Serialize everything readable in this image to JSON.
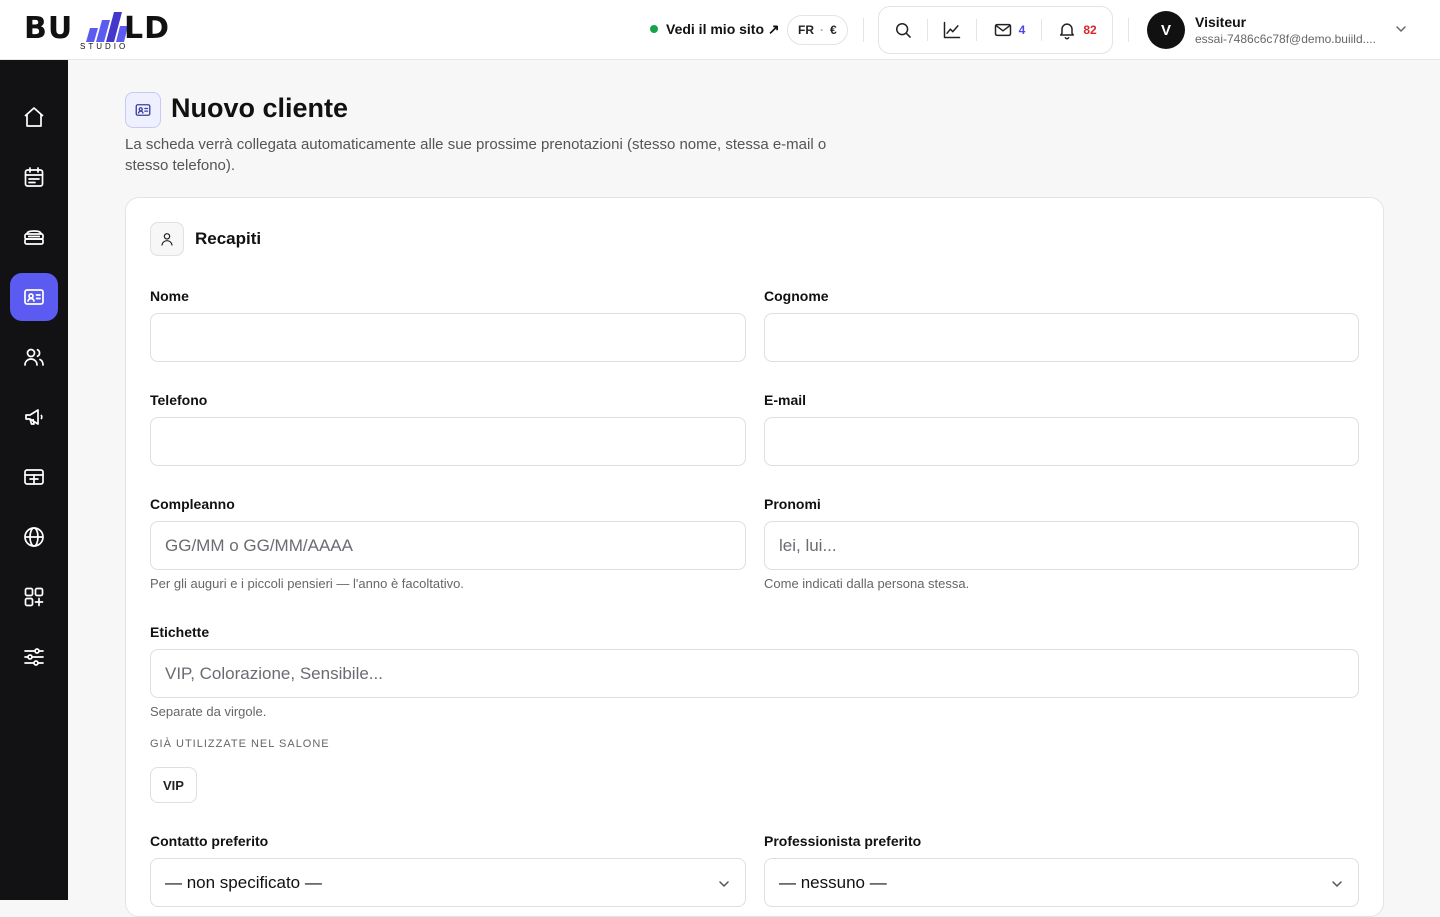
{
  "header": {
    "logo": {
      "left": "BU",
      "right": "LD",
      "sub": "STUDIO"
    },
    "site_link": "Vedi il mio sito ↗",
    "lang": "FR",
    "currency": "€",
    "mail_count": "4",
    "notif_count": "82",
    "user": {
      "initial": "V",
      "name": "Visiteur",
      "email": "essai-7486c6c78f@demo.buiild...."
    }
  },
  "sidebar": {
    "items": [
      {
        "icon": "home-icon"
      },
      {
        "icon": "calendar-icon"
      },
      {
        "icon": "services-icon"
      },
      {
        "icon": "client-card-icon",
        "active": true
      },
      {
        "icon": "team-icon"
      },
      {
        "icon": "megaphone-icon"
      },
      {
        "icon": "payment-icon"
      },
      {
        "icon": "globe-icon"
      },
      {
        "icon": "apps-icon"
      },
      {
        "icon": "settings-sliders-icon"
      }
    ]
  },
  "page": {
    "title": "Nuovo cliente",
    "subtitle": "La scheda verrà collegata automaticamente alle sue prossime prenotazioni (stesso nome, stessa e-mail o stesso telefono)."
  },
  "form": {
    "section_title": "Recapiti",
    "nome": {
      "label": "Nome",
      "value": "",
      "placeholder": ""
    },
    "cognome": {
      "label": "Cognome",
      "value": "",
      "placeholder": ""
    },
    "telefono": {
      "label": "Telefono",
      "value": "",
      "placeholder": ""
    },
    "email": {
      "label": "E-mail",
      "value": "",
      "placeholder": ""
    },
    "compleanno": {
      "label": "Compleanno",
      "placeholder": "GG/MM o GG/MM/AAAA",
      "help": "Per gli auguri e i piccoli pensieri — l'anno è facoltativo."
    },
    "pronomi": {
      "label": "Pronomi",
      "placeholder": "lei, lui...",
      "help": "Come indicati dalla persona stessa."
    },
    "etichette": {
      "label": "Etichette",
      "placeholder": "VIP, Colorazione, Sensibile...",
      "help": "Separate da virgole.",
      "used_heading": "GIÀ UTILIZZATE NEL SALONE",
      "used_tags": [
        "VIP"
      ]
    },
    "contatto": {
      "label": "Contatto preferito",
      "value": "— non specificato —"
    },
    "professionista": {
      "label": "Professionista preferito",
      "value": "— nessuno —"
    }
  },
  "colors": {
    "accent": "#5b5bf2",
    "sidebar_bg": "#121214",
    "online": "#16a34a",
    "mail_badge": "#4f46e5",
    "notif_badge": "#dc2626"
  }
}
